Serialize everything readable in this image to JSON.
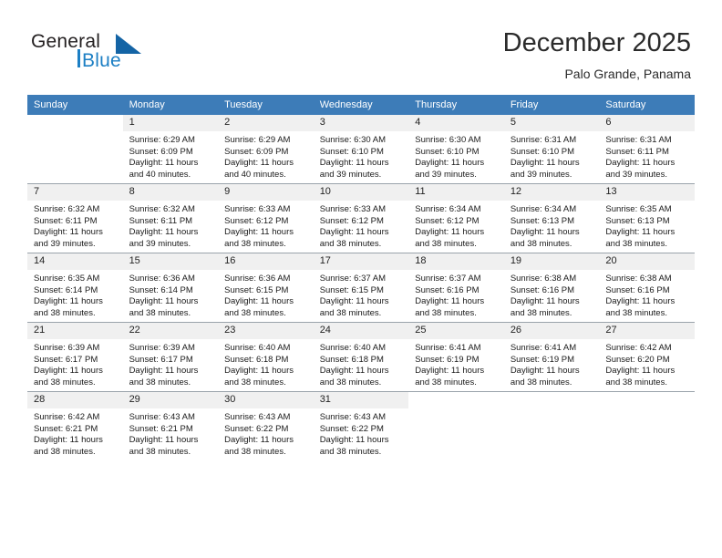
{
  "brand": {
    "name_top": "General",
    "name_bottom": "Blue",
    "accent_color": "#1c7fc4",
    "triangle_color": "#1464a5"
  },
  "header": {
    "title": "December 2025",
    "location": "Palo Grande, Panama"
  },
  "theme": {
    "header_row_bg": "#3d7cb8",
    "header_row_text": "#ffffff",
    "daynum_bg": "#f0f0f0",
    "grid_line": "#9aa3ab"
  },
  "weekdays": [
    "Sunday",
    "Monday",
    "Tuesday",
    "Wednesday",
    "Thursday",
    "Friday",
    "Saturday"
  ],
  "labels": {
    "sunrise": "Sunrise:",
    "sunset": "Sunset:",
    "daylight": "Daylight:"
  },
  "weeks": [
    [
      {
        "day": "",
        "sunrise": "",
        "sunset": "",
        "daylight_line1": "",
        "daylight_line2": "",
        "blank": true
      },
      {
        "day": "1",
        "sunrise": "Sunrise: 6:29 AM",
        "sunset": "Sunset: 6:09 PM",
        "daylight_line1": "Daylight: 11 hours",
        "daylight_line2": "and 40 minutes."
      },
      {
        "day": "2",
        "sunrise": "Sunrise: 6:29 AM",
        "sunset": "Sunset: 6:09 PM",
        "daylight_line1": "Daylight: 11 hours",
        "daylight_line2": "and 40 minutes."
      },
      {
        "day": "3",
        "sunrise": "Sunrise: 6:30 AM",
        "sunset": "Sunset: 6:10 PM",
        "daylight_line1": "Daylight: 11 hours",
        "daylight_line2": "and 39 minutes."
      },
      {
        "day": "4",
        "sunrise": "Sunrise: 6:30 AM",
        "sunset": "Sunset: 6:10 PM",
        "daylight_line1": "Daylight: 11 hours",
        "daylight_line2": "and 39 minutes."
      },
      {
        "day": "5",
        "sunrise": "Sunrise: 6:31 AM",
        "sunset": "Sunset: 6:10 PM",
        "daylight_line1": "Daylight: 11 hours",
        "daylight_line2": "and 39 minutes."
      },
      {
        "day": "6",
        "sunrise": "Sunrise: 6:31 AM",
        "sunset": "Sunset: 6:11 PM",
        "daylight_line1": "Daylight: 11 hours",
        "daylight_line2": "and 39 minutes."
      }
    ],
    [
      {
        "day": "7",
        "sunrise": "Sunrise: 6:32 AM",
        "sunset": "Sunset: 6:11 PM",
        "daylight_line1": "Daylight: 11 hours",
        "daylight_line2": "and 39 minutes."
      },
      {
        "day": "8",
        "sunrise": "Sunrise: 6:32 AM",
        "sunset": "Sunset: 6:11 PM",
        "daylight_line1": "Daylight: 11 hours",
        "daylight_line2": "and 39 minutes."
      },
      {
        "day": "9",
        "sunrise": "Sunrise: 6:33 AM",
        "sunset": "Sunset: 6:12 PM",
        "daylight_line1": "Daylight: 11 hours",
        "daylight_line2": "and 38 minutes."
      },
      {
        "day": "10",
        "sunrise": "Sunrise: 6:33 AM",
        "sunset": "Sunset: 6:12 PM",
        "daylight_line1": "Daylight: 11 hours",
        "daylight_line2": "and 38 minutes."
      },
      {
        "day": "11",
        "sunrise": "Sunrise: 6:34 AM",
        "sunset": "Sunset: 6:12 PM",
        "daylight_line1": "Daylight: 11 hours",
        "daylight_line2": "and 38 minutes."
      },
      {
        "day": "12",
        "sunrise": "Sunrise: 6:34 AM",
        "sunset": "Sunset: 6:13 PM",
        "daylight_line1": "Daylight: 11 hours",
        "daylight_line2": "and 38 minutes."
      },
      {
        "day": "13",
        "sunrise": "Sunrise: 6:35 AM",
        "sunset": "Sunset: 6:13 PM",
        "daylight_line1": "Daylight: 11 hours",
        "daylight_line2": "and 38 minutes."
      }
    ],
    [
      {
        "day": "14",
        "sunrise": "Sunrise: 6:35 AM",
        "sunset": "Sunset: 6:14 PM",
        "daylight_line1": "Daylight: 11 hours",
        "daylight_line2": "and 38 minutes."
      },
      {
        "day": "15",
        "sunrise": "Sunrise: 6:36 AM",
        "sunset": "Sunset: 6:14 PM",
        "daylight_line1": "Daylight: 11 hours",
        "daylight_line2": "and 38 minutes."
      },
      {
        "day": "16",
        "sunrise": "Sunrise: 6:36 AM",
        "sunset": "Sunset: 6:15 PM",
        "daylight_line1": "Daylight: 11 hours",
        "daylight_line2": "and 38 minutes."
      },
      {
        "day": "17",
        "sunrise": "Sunrise: 6:37 AM",
        "sunset": "Sunset: 6:15 PM",
        "daylight_line1": "Daylight: 11 hours",
        "daylight_line2": "and 38 minutes."
      },
      {
        "day": "18",
        "sunrise": "Sunrise: 6:37 AM",
        "sunset": "Sunset: 6:16 PM",
        "daylight_line1": "Daylight: 11 hours",
        "daylight_line2": "and 38 minutes."
      },
      {
        "day": "19",
        "sunrise": "Sunrise: 6:38 AM",
        "sunset": "Sunset: 6:16 PM",
        "daylight_line1": "Daylight: 11 hours",
        "daylight_line2": "and 38 minutes."
      },
      {
        "day": "20",
        "sunrise": "Sunrise: 6:38 AM",
        "sunset": "Sunset: 6:16 PM",
        "daylight_line1": "Daylight: 11 hours",
        "daylight_line2": "and 38 minutes."
      }
    ],
    [
      {
        "day": "21",
        "sunrise": "Sunrise: 6:39 AM",
        "sunset": "Sunset: 6:17 PM",
        "daylight_line1": "Daylight: 11 hours",
        "daylight_line2": "and 38 minutes."
      },
      {
        "day": "22",
        "sunrise": "Sunrise: 6:39 AM",
        "sunset": "Sunset: 6:17 PM",
        "daylight_line1": "Daylight: 11 hours",
        "daylight_line2": "and 38 minutes."
      },
      {
        "day": "23",
        "sunrise": "Sunrise: 6:40 AM",
        "sunset": "Sunset: 6:18 PM",
        "daylight_line1": "Daylight: 11 hours",
        "daylight_line2": "and 38 minutes."
      },
      {
        "day": "24",
        "sunrise": "Sunrise: 6:40 AM",
        "sunset": "Sunset: 6:18 PM",
        "daylight_line1": "Daylight: 11 hours",
        "daylight_line2": "and 38 minutes."
      },
      {
        "day": "25",
        "sunrise": "Sunrise: 6:41 AM",
        "sunset": "Sunset: 6:19 PM",
        "daylight_line1": "Daylight: 11 hours",
        "daylight_line2": "and 38 minutes."
      },
      {
        "day": "26",
        "sunrise": "Sunrise: 6:41 AM",
        "sunset": "Sunset: 6:19 PM",
        "daylight_line1": "Daylight: 11 hours",
        "daylight_line2": "and 38 minutes."
      },
      {
        "day": "27",
        "sunrise": "Sunrise: 6:42 AM",
        "sunset": "Sunset: 6:20 PM",
        "daylight_line1": "Daylight: 11 hours",
        "daylight_line2": "and 38 minutes."
      }
    ],
    [
      {
        "day": "28",
        "sunrise": "Sunrise: 6:42 AM",
        "sunset": "Sunset: 6:21 PM",
        "daylight_line1": "Daylight: 11 hours",
        "daylight_line2": "and 38 minutes."
      },
      {
        "day": "29",
        "sunrise": "Sunrise: 6:43 AM",
        "sunset": "Sunset: 6:21 PM",
        "daylight_line1": "Daylight: 11 hours",
        "daylight_line2": "and 38 minutes."
      },
      {
        "day": "30",
        "sunrise": "Sunrise: 6:43 AM",
        "sunset": "Sunset: 6:22 PM",
        "daylight_line1": "Daylight: 11 hours",
        "daylight_line2": "and 38 minutes."
      },
      {
        "day": "31",
        "sunrise": "Sunrise: 6:43 AM",
        "sunset": "Sunset: 6:22 PM",
        "daylight_line1": "Daylight: 11 hours",
        "daylight_line2": "and 38 minutes."
      },
      {
        "day": "",
        "sunrise": "",
        "sunset": "",
        "daylight_line1": "",
        "daylight_line2": "",
        "blank": true
      },
      {
        "day": "",
        "sunrise": "",
        "sunset": "",
        "daylight_line1": "",
        "daylight_line2": "",
        "blank": true
      },
      {
        "day": "",
        "sunrise": "",
        "sunset": "",
        "daylight_line1": "",
        "daylight_line2": "",
        "blank": true
      }
    ]
  ]
}
